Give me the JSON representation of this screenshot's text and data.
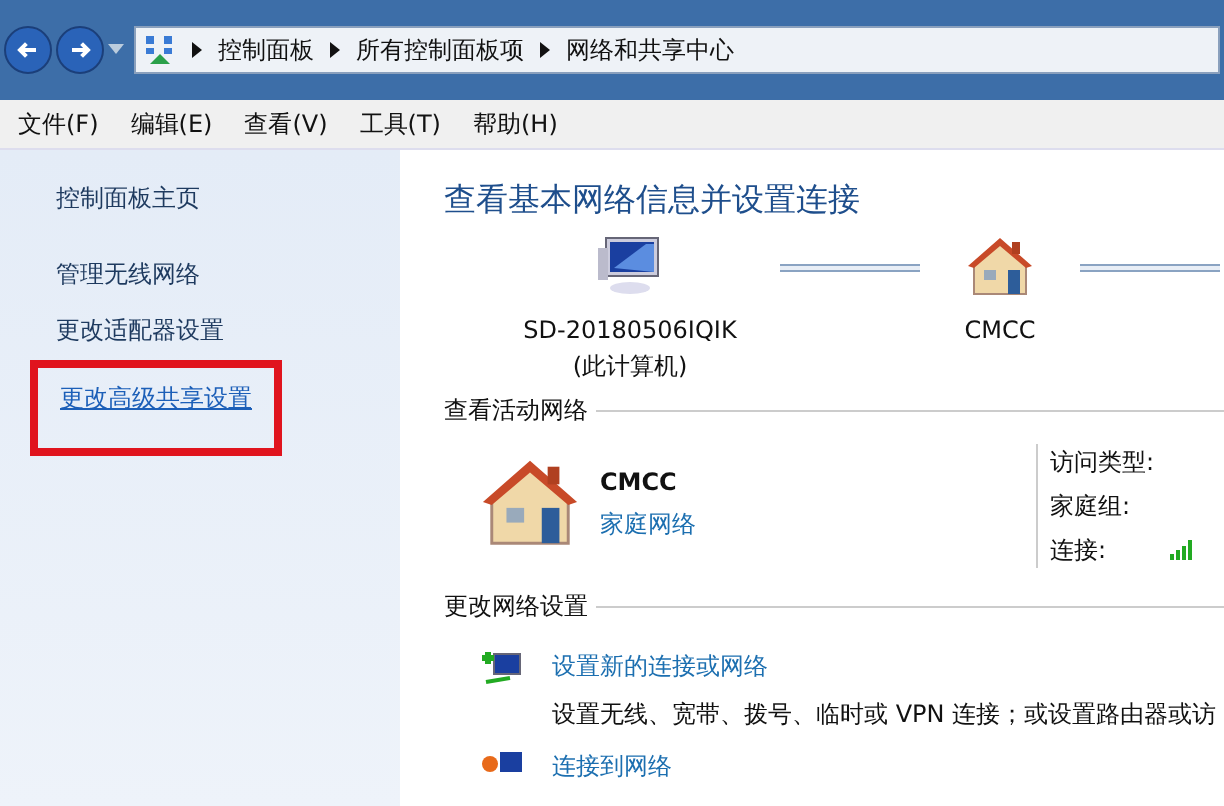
{
  "breadcrumb": [
    "控制面板",
    "所有控制面板项",
    "网络和共享中心"
  ],
  "menu": [
    "文件(F)",
    "编辑(E)",
    "查看(V)",
    "工具(T)",
    "帮助(H)"
  ],
  "sidebar": {
    "home": "控制面板主页",
    "links": [
      {
        "label": "管理无线网络",
        "highlighted": false
      },
      {
        "label": "更改适配器设置",
        "highlighted": false
      },
      {
        "label": "更改高级共享设置",
        "highlighted": true
      }
    ]
  },
  "main": {
    "title": "查看基本网络信息并设置连接",
    "map": [
      {
        "kind": "computer",
        "name": "SD-20180506IQIK",
        "note": "(此计算机)"
      },
      {
        "kind": "house",
        "name": "CMCC"
      }
    ],
    "active_section": "查看活动网络",
    "active_network": {
      "name": "CMCC",
      "type": "家庭网络",
      "props": [
        "访问类型:",
        "家庭组:",
        "连接:"
      ]
    },
    "settings_section": "更改网络设置",
    "tasks": [
      {
        "kind": "new",
        "link": "设置新的连接或网络",
        "description": "设置无线、宽带、拨号、临时或 VPN 连接；或设置路由器或访"
      },
      {
        "kind": "connect",
        "link": "连接到网络"
      }
    ]
  }
}
